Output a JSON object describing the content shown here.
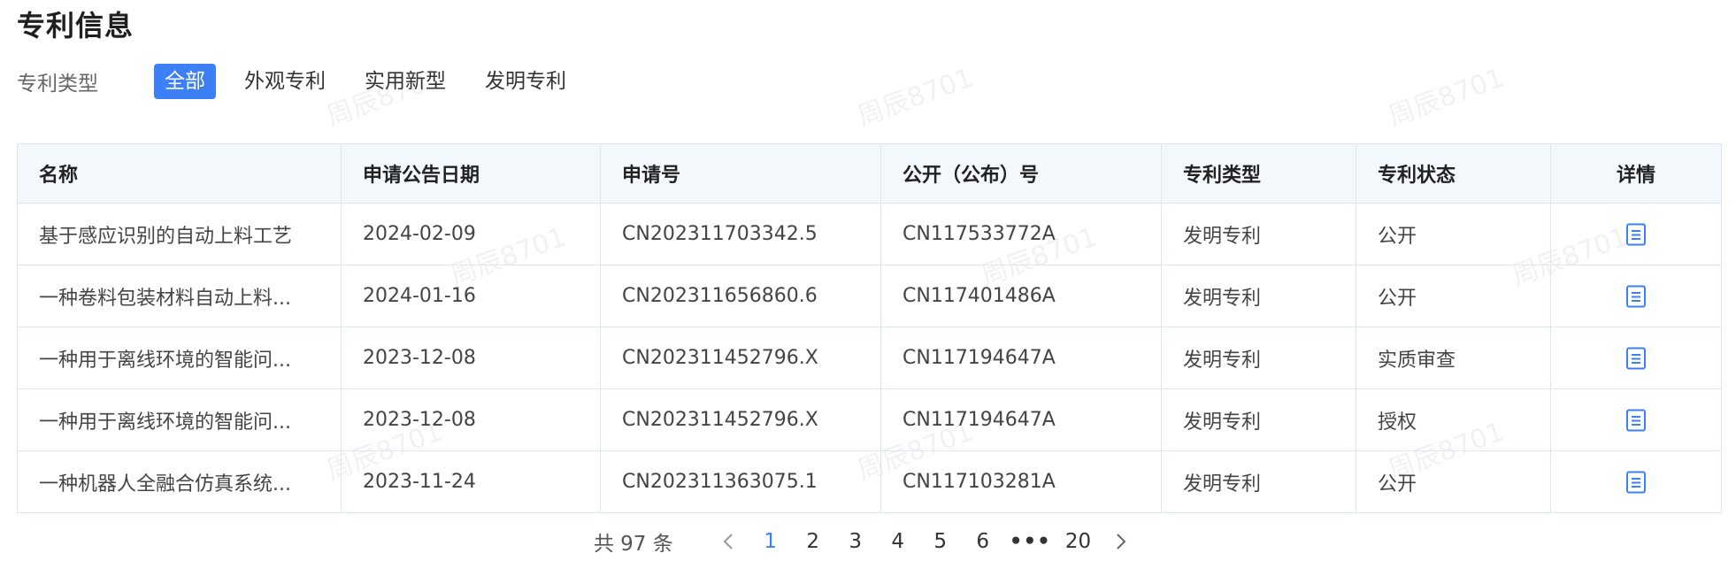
{
  "page": {
    "title": "专利信息"
  },
  "filter": {
    "label": "专利类型",
    "options": [
      "全部",
      "外观专利",
      "实用新型",
      "发明专利"
    ],
    "selected": "全部"
  },
  "table": {
    "headers": [
      "名称",
      "申请公告日期",
      "申请号",
      "公开（公布）号",
      "专利类型",
      "专利状态",
      "详情"
    ],
    "rows": [
      [
        "基于感应识别的自动上料工艺",
        "2024-02-09",
        "CN202311703342.5",
        "CN117533772A",
        "发明专利",
        "公开"
      ],
      [
        "一种卷料包装材料自动上料...",
        "2024-01-16",
        "CN202311656860.6",
        "CN117401486A",
        "发明专利",
        "公开"
      ],
      [
        "一种用于离线环境的智能问...",
        "2023-12-08",
        "CN202311452796.X",
        "CN117194647A",
        "发明专利",
        "实质审查"
      ],
      [
        "一种用于离线环境的智能问...",
        "2023-12-08",
        "CN202311452796.X",
        "CN117194647A",
        "发明专利",
        "授权"
      ],
      [
        "一种机器人全融合仿真系统...",
        "2023-11-24",
        "CN202311363075.1",
        "CN117103281A",
        "发明专利",
        "公开"
      ]
    ],
    "detail_icon": "document-icon"
  },
  "pagination": {
    "total_text": "共 97 条",
    "pages": [
      "1",
      "2",
      "3",
      "4",
      "5",
      "6"
    ],
    "current": "1",
    "ellipsis": "•••",
    "last": "20"
  },
  "watermark": {
    "text": "周辰8701"
  },
  "colors": {
    "accent": "#3d7ff5",
    "header_bg": "#f3f8fc",
    "border": "#dde6f0"
  }
}
